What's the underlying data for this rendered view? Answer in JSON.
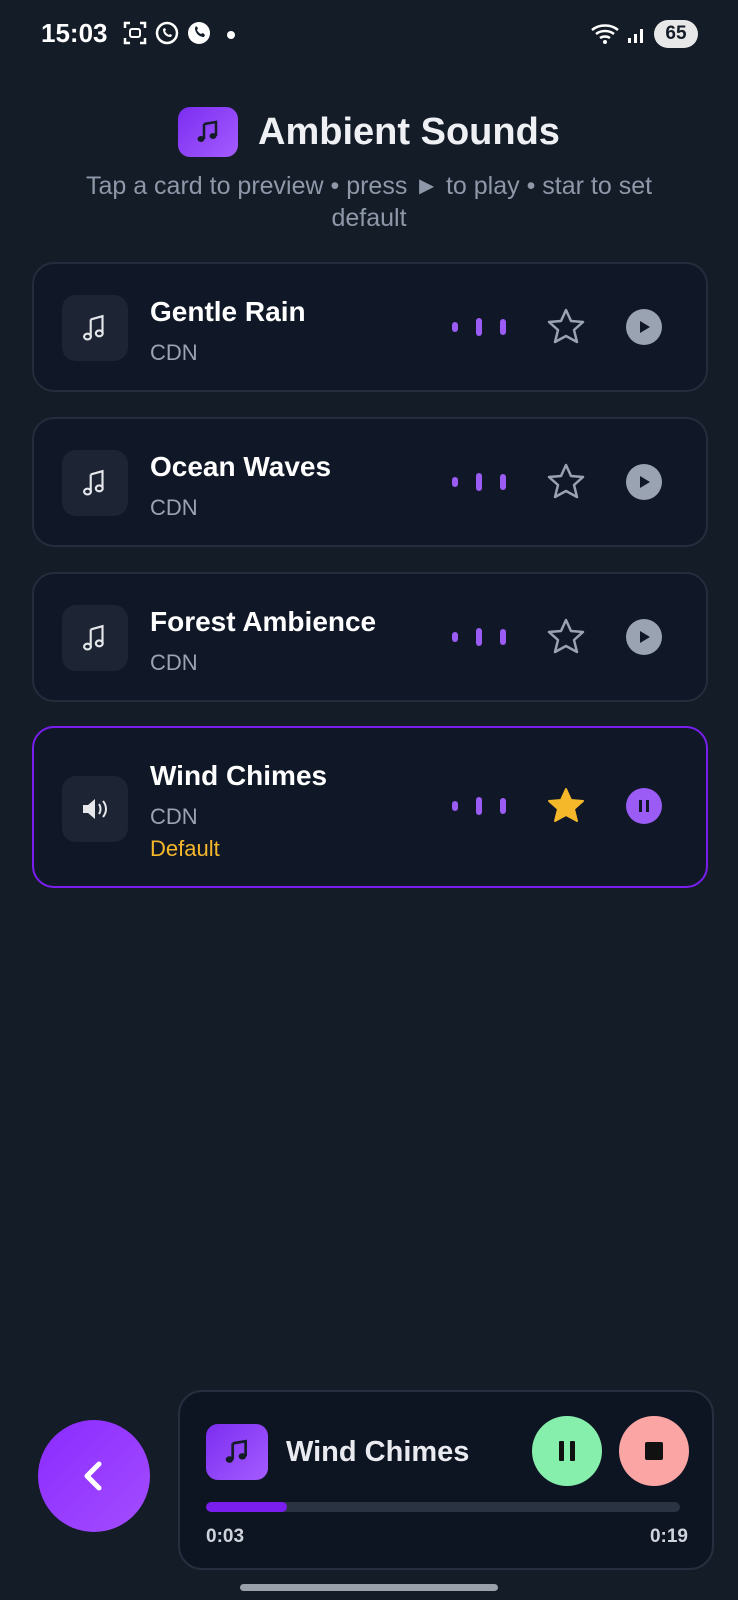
{
  "status_bar": {
    "time": "15:03",
    "battery": "65",
    "icons_left": [
      "screenshot-icon",
      "whatsapp-icon",
      "viber-icon"
    ],
    "icons_right": [
      "wifi-icon",
      "signal-icon"
    ]
  },
  "header": {
    "title": "Ambient Sounds",
    "subtitle": "Tap a card to preview • press ► to play • star to set default",
    "icon": "music-note-icon"
  },
  "sounds": [
    {
      "title": "Gentle Rain",
      "source": "CDN",
      "starred": false,
      "playing": false,
      "icon": "music-note-icon",
      "default_label": ""
    },
    {
      "title": "Ocean Waves",
      "source": "CDN",
      "starred": false,
      "playing": false,
      "icon": "music-note-icon",
      "default_label": ""
    },
    {
      "title": "Forest Ambience",
      "source": "CDN",
      "starred": false,
      "playing": false,
      "icon": "music-note-icon",
      "default_label": ""
    },
    {
      "title": "Wind Chimes",
      "source": "CDN",
      "starred": true,
      "playing": true,
      "icon": "speaker-icon",
      "default_label": "Default"
    }
  ],
  "player": {
    "title": "Wind Chimes",
    "current_time": "0:03",
    "total_time": "0:19",
    "progress": 0.17
  },
  "colors": {
    "background": "#141c28",
    "accent": "#7a1ef0",
    "star": "#f5b82a",
    "pause": "#86efac",
    "stop": "#fca5a5"
  }
}
